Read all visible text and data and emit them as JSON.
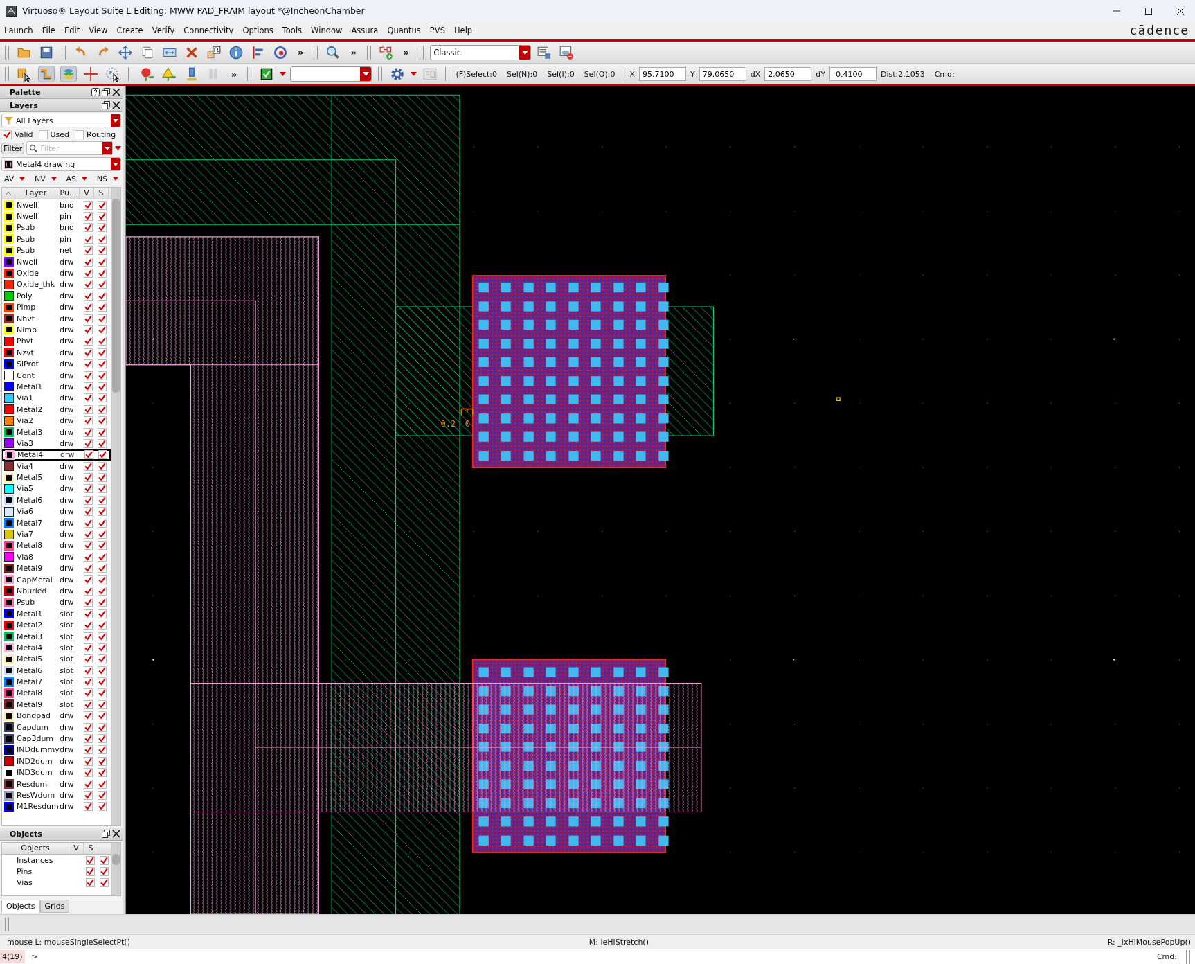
{
  "window": {
    "title": "Virtuoso® Layout Suite L Editing: MWW PAD_FRAIM layout *@IncheonChamber"
  },
  "menu": [
    "Launch",
    "File",
    "Edit",
    "View",
    "Create",
    "Verify",
    "Connectivity",
    "Options",
    "Tools",
    "Window",
    "Assura",
    "Quantus",
    "PVS",
    "Help"
  ],
  "logo": "cādence",
  "toolbar1": {
    "overflow_marks": [
      "»",
      "»",
      "»"
    ],
    "workspace": "Classic"
  },
  "toolbar2": {
    "overflow_mark": "»",
    "selection_counts": [
      "(F)Select:0",
      "Sel(N):0",
      "Sel(I):0",
      "Sel(O):0"
    ],
    "coordinates": [
      {
        "label": "X",
        "value": "95.7100"
      },
      {
        "label": "Y",
        "value": "79.0650"
      },
      {
        "label": "dX",
        "value": "2.0650"
      },
      {
        "label": "dY",
        "value": "-0.4100"
      }
    ],
    "distance": "Dist:2.1053",
    "cmd_label": "Cmd:"
  },
  "palette": {
    "title": "Palette",
    "layers_title": "Layers",
    "layer_set": "All Layers",
    "filters": [
      {
        "label": "Valid",
        "checked": true
      },
      {
        "label": "Used",
        "checked": false
      },
      {
        "label": "Routing",
        "checked": false
      }
    ],
    "filter_button": "Filter",
    "filter_placeholder": "Filter",
    "current_layer": "Metal4 drawing",
    "visibility_menus": [
      "AV",
      "NV",
      "AS",
      "NS"
    ],
    "columns": [
      "Layer",
      "Pu...",
      "V",
      "S"
    ],
    "layers": [
      {
        "name": "Nwell",
        "purpose": "bnd",
        "kind": "outline",
        "color": "#ffff00",
        "visible": true,
        "selectable": true,
        "selected": false
      },
      {
        "name": "Nwell",
        "purpose": "pin",
        "kind": "outline",
        "color": "#ffff00",
        "visible": true,
        "selectable": true,
        "selected": false
      },
      {
        "name": "Psub",
        "purpose": "bnd",
        "kind": "outline",
        "color": "#ffff00",
        "visible": true,
        "selectable": true,
        "selected": false
      },
      {
        "name": "Psub",
        "purpose": "pin",
        "kind": "outline",
        "color": "#ffff00",
        "visible": true,
        "selectable": true,
        "selected": false
      },
      {
        "name": "Psub",
        "purpose": "net",
        "kind": "outline",
        "color": "#ffff00",
        "visible": true,
        "selectable": true,
        "selected": false
      },
      {
        "name": "Nwell",
        "purpose": "drw",
        "kind": "outline",
        "color": "#8000ff",
        "visible": true,
        "selectable": true,
        "selected": false
      },
      {
        "name": "Oxide",
        "purpose": "drw",
        "kind": "outline",
        "color": "#ff2000",
        "visible": true,
        "selectable": true,
        "selected": false
      },
      {
        "name": "Oxide_thk",
        "purpose": "drw",
        "kind": "solid",
        "color": "#ff2000",
        "visible": true,
        "selectable": true,
        "selected": false
      },
      {
        "name": "Poly",
        "purpose": "drw",
        "kind": "solid",
        "color": "#00cc00",
        "visible": true,
        "selectable": true,
        "selected": false
      },
      {
        "name": "Pimp",
        "purpose": "drw",
        "kind": "outline",
        "color": "#ff4000",
        "visible": true,
        "selectable": true,
        "selected": false
      },
      {
        "name": "Nhvt",
        "purpose": "drw",
        "kind": "outline",
        "color": "#a03020",
        "visible": true,
        "selectable": true,
        "selected": false
      },
      {
        "name": "Nimp",
        "purpose": "drw",
        "kind": "outline",
        "color": "#ffff00",
        "visible": true,
        "selectable": true,
        "selected": false
      },
      {
        "name": "Phvt",
        "purpose": "drw",
        "kind": "solid",
        "color": "#ff0000",
        "visible": true,
        "selectable": true,
        "selected": false
      },
      {
        "name": "Nzvt",
        "purpose": "drw",
        "kind": "outline",
        "color": "#ff0000",
        "visible": true,
        "selectable": true,
        "selected": false
      },
      {
        "name": "SiProt",
        "purpose": "drw",
        "kind": "outline",
        "color": "#0000ff",
        "visible": true,
        "selectable": true,
        "selected": false
      },
      {
        "name": "Cont",
        "purpose": "drw",
        "kind": "solid",
        "color": "#ffffff",
        "visible": true,
        "selectable": true,
        "selected": false
      },
      {
        "name": "Metal1",
        "purpose": "drw",
        "kind": "solid",
        "color": "#0000ff",
        "visible": true,
        "selectable": true,
        "selected": false
      },
      {
        "name": "Via1",
        "purpose": "drw",
        "kind": "solid",
        "color": "#33ccff",
        "visible": true,
        "selectable": true,
        "selected": false
      },
      {
        "name": "Metal2",
        "purpose": "drw",
        "kind": "solid",
        "color": "#ff0000",
        "visible": true,
        "selectable": true,
        "selected": false
      },
      {
        "name": "Via2",
        "purpose": "drw",
        "kind": "solid",
        "color": "#ff8000",
        "visible": true,
        "selectable": true,
        "selected": false
      },
      {
        "name": "Metal3",
        "purpose": "drw",
        "kind": "outline",
        "color": "#00c060",
        "visible": true,
        "selectable": true,
        "selected": false
      },
      {
        "name": "Via3",
        "purpose": "drw",
        "kind": "solid",
        "color": "#9900ff",
        "visible": true,
        "selectable": true,
        "selected": false
      },
      {
        "name": "Metal4",
        "purpose": "drw",
        "kind": "outline",
        "color": "#ffb0e0",
        "visible": true,
        "selectable": true,
        "selected": true
      },
      {
        "name": "Via4",
        "purpose": "drw",
        "kind": "solid",
        "color": "#8b3030",
        "visible": true,
        "selectable": true,
        "selected": false
      },
      {
        "name": "Metal5",
        "purpose": "drw",
        "kind": "outline",
        "color": "#fff0b0",
        "visible": true,
        "selectable": true,
        "selected": false
      },
      {
        "name": "Via5",
        "purpose": "drw",
        "kind": "solid",
        "color": "#00ffff",
        "visible": true,
        "selectable": true,
        "selected": false
      },
      {
        "name": "Metal6",
        "purpose": "drw",
        "kind": "outline",
        "color": "#d0e0ff",
        "visible": true,
        "selectable": true,
        "selected": false
      },
      {
        "name": "Via6",
        "purpose": "drw",
        "kind": "solid",
        "color": "#d8e8ff",
        "visible": true,
        "selectable": true,
        "selected": false
      },
      {
        "name": "Metal7",
        "purpose": "drw",
        "kind": "outline",
        "color": "#0080ff",
        "visible": true,
        "selectable": true,
        "selected": false
      },
      {
        "name": "Via7",
        "purpose": "drw",
        "kind": "solid",
        "color": "#d4c800",
        "visible": true,
        "selectable": true,
        "selected": false
      },
      {
        "name": "Metal8",
        "purpose": "drw",
        "kind": "outline",
        "color": "#ff4090",
        "visible": true,
        "selectable": true,
        "selected": false
      },
      {
        "name": "Via8",
        "purpose": "drw",
        "kind": "solid",
        "color": "#ff00ff",
        "visible": true,
        "selectable": true,
        "selected": false
      },
      {
        "name": "Metal9",
        "purpose": "drw",
        "kind": "outline",
        "color": "#7a2020",
        "visible": true,
        "selectable": true,
        "selected": false
      },
      {
        "name": "CapMetal",
        "purpose": "drw",
        "kind": "outline",
        "color": "#ffa0d0",
        "visible": true,
        "selectable": true,
        "selected": false
      },
      {
        "name": "Nburied",
        "purpose": "drw",
        "kind": "outline",
        "color": "#cc0000",
        "visible": true,
        "selectable": true,
        "selected": false
      },
      {
        "name": "Psub",
        "purpose": "drw",
        "kind": "outline",
        "color": "#ff60a0",
        "visible": true,
        "selectable": true,
        "selected": false
      },
      {
        "name": "Metal1",
        "purpose": "slot",
        "kind": "outline",
        "color": "#0000ff",
        "visible": true,
        "selectable": true,
        "selected": false
      },
      {
        "name": "Metal2",
        "purpose": "slot",
        "kind": "outline",
        "color": "#ff0000",
        "visible": true,
        "selectable": true,
        "selected": false
      },
      {
        "name": "Metal3",
        "purpose": "slot",
        "kind": "outline",
        "color": "#00c060",
        "visible": true,
        "selectable": true,
        "selected": false
      },
      {
        "name": "Metal4",
        "purpose": "slot",
        "kind": "outline",
        "color": "#ffb0e0",
        "visible": true,
        "selectable": true,
        "selected": false
      },
      {
        "name": "Metal5",
        "purpose": "slot",
        "kind": "outline",
        "color": "#fff0b0",
        "visible": true,
        "selectable": true,
        "selected": false
      },
      {
        "name": "Metal6",
        "purpose": "slot",
        "kind": "outline",
        "color": "#d0e0ff",
        "visible": true,
        "selectable": true,
        "selected": false
      },
      {
        "name": "Metal7",
        "purpose": "slot",
        "kind": "outline",
        "color": "#0080ff",
        "visible": true,
        "selectable": true,
        "selected": false
      },
      {
        "name": "Metal8",
        "purpose": "slot",
        "kind": "outline",
        "color": "#ff4090",
        "visible": true,
        "selectable": true,
        "selected": false
      },
      {
        "name": "Metal9",
        "purpose": "slot",
        "kind": "outline",
        "color": "#7a2020",
        "visible": true,
        "selectable": true,
        "selected": false
      },
      {
        "name": "Bondpad",
        "purpose": "drw",
        "kind": "outline",
        "color": "#fff0b0",
        "visible": true,
        "selectable": true,
        "selected": false
      },
      {
        "name": "Capdum",
        "purpose": "drw",
        "kind": "outline",
        "color": "#404060",
        "visible": true,
        "selectable": true,
        "selected": false
      },
      {
        "name": "Cap3dum",
        "purpose": "drw",
        "kind": "outline",
        "color": "#404060",
        "visible": true,
        "selectable": true,
        "selected": false
      },
      {
        "name": "INDdummy",
        "purpose": "drw",
        "kind": "outline",
        "color": "#0000a0",
        "visible": true,
        "selectable": true,
        "selected": false
      },
      {
        "name": "IND2dum",
        "purpose": "drw",
        "kind": "solid",
        "color": "#cc0000",
        "visible": true,
        "selectable": true,
        "selected": false
      },
      {
        "name": "IND3dum",
        "purpose": "drw",
        "kind": "outline",
        "color": "#ffffff",
        "visible": true,
        "selectable": true,
        "selected": false
      },
      {
        "name": "Resdum",
        "purpose": "drw",
        "kind": "outline",
        "color": "#803030",
        "visible": true,
        "selectable": true,
        "selected": false
      },
      {
        "name": "ResWdum",
        "purpose": "drw",
        "kind": "outline",
        "color": "#a0a0c0",
        "visible": true,
        "selectable": true,
        "selected": false
      },
      {
        "name": "M1Resdum",
        "purpose": "drw",
        "kind": "outline",
        "color": "#0000ff",
        "visible": true,
        "selectable": true,
        "selected": false
      }
    ]
  },
  "objects": {
    "title": "Objects",
    "columns": [
      "Objects",
      "V",
      "S"
    ],
    "rows": [
      {
        "name": "Instances",
        "visible": true,
        "selectable": true
      },
      {
        "name": "Pins",
        "visible": true,
        "selectable": true
      },
      {
        "name": "Vias",
        "visible": true,
        "selectable": true
      }
    ]
  },
  "panel_tabs": [
    {
      "label": "Objects",
      "selected": true
    },
    {
      "label": "Grids",
      "selected": false
    }
  ],
  "canvas": {
    "ruler_labels": [
      "0.2",
      "0"
    ]
  },
  "status_bar": {
    "mouse_left": "mouse L: mouseSingleSelectPt()",
    "mouse_middle": "M: leHiStretch()",
    "mouse_right": "R: _lxHiMousePopUp()"
  },
  "command_line": {
    "counter": "4(19)",
    "prompt": ">",
    "cmd_label": "Cmd:"
  }
}
